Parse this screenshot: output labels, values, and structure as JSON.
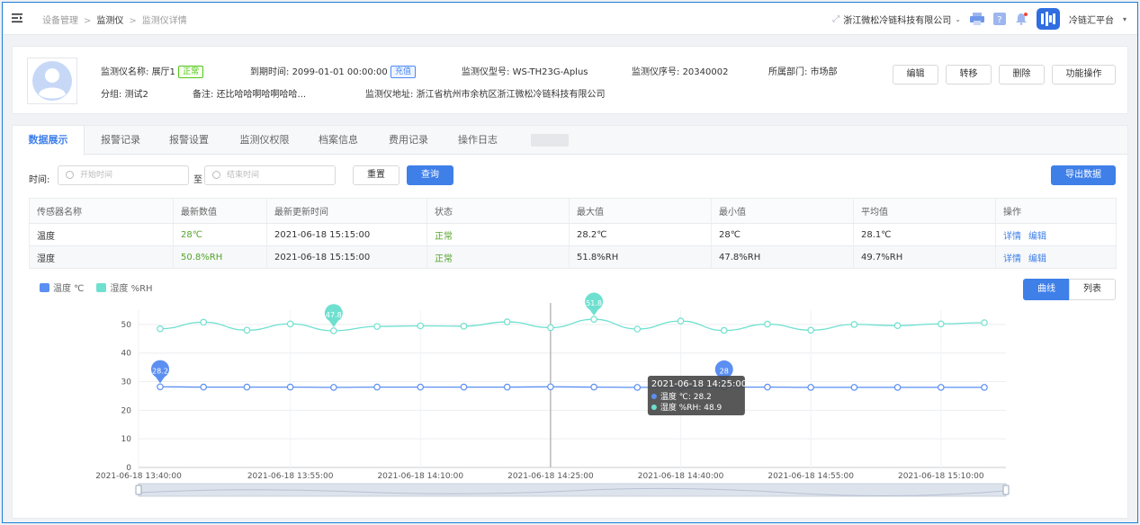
{
  "breadcrumb": {
    "items": [
      "设备管理",
      "监测仪",
      "监测仪详情"
    ],
    "sep": ">"
  },
  "topbar": {
    "company": "浙江微松冷链科技有限公司",
    "platform": "冷链汇平台",
    "company_caret": "⌄",
    "platform_caret": "▾"
  },
  "device": {
    "name_label": "监测仪名称:",
    "name": "展厅1",
    "status": "正常",
    "expire_label": "到期时间:",
    "expire": "2099-01-01 00:00:00",
    "recharge": "充值",
    "model_label": "监测仪型号:",
    "model": "WS-TH23G-Aplus",
    "serial_label": "监测仪序号:",
    "serial": "20340002",
    "dept_label": "所属部门:",
    "dept": "市场部",
    "group_label": "分组:",
    "group": "测试2",
    "remark_label": "备注:",
    "remark": "还比哈哈啊哈啊哈哈...",
    "address_label": "监测仪地址:",
    "address": "浙江省杭州市余杭区浙江微松冷链科技有限公司"
  },
  "actions": {
    "edit": "编辑",
    "transfer": "转移",
    "delete": "删除",
    "functions": "功能操作"
  },
  "tabs": [
    "数据展示",
    "报警记录",
    "报警设置",
    "监测仪权限",
    "档案信息",
    "费用记录",
    "操作日志"
  ],
  "filter": {
    "time_label": "时间:",
    "start_placeholder": "开始时间",
    "to": "至",
    "end_placeholder": "结束时间",
    "reset": "重置",
    "query": "查询",
    "export": "导出数据"
  },
  "table": {
    "headers": [
      "传感器名称",
      "最新数值",
      "最新更新时间",
      "状态",
      "最大值",
      "最小值",
      "平均值",
      "操作"
    ],
    "rows": [
      {
        "name": "温度",
        "latest": "28℃",
        "time": "2021-06-18 15:15:00",
        "status": "正常",
        "max": "28.2℃",
        "min": "28℃",
        "avg": "28.1℃",
        "op1": "详情",
        "op2": "编辑"
      },
      {
        "name": "湿度",
        "latest": "50.8%RH",
        "time": "2021-06-18 15:15:00",
        "status": "正常",
        "max": "51.8%RH",
        "min": "47.8%RH",
        "avg": "49.7%RH",
        "op1": "详情",
        "op2": "编辑"
      }
    ]
  },
  "view_toggle": {
    "curve": "曲线",
    "list": "列表"
  },
  "colors": {
    "accent": "#3f7fe8",
    "temp": "#5b8ff2",
    "humidity": "#6fe0cf",
    "ok": "#52a42a"
  },
  "chart_data": {
    "type": "line",
    "x": [
      "2021-06-18 13:40:00",
      "2021-06-18 13:45:00",
      "2021-06-18 13:50:00",
      "2021-06-18 13:55:00",
      "2021-06-18 14:00:00",
      "2021-06-18 14:05:00",
      "2021-06-18 14:10:00",
      "2021-06-18 14:15:00",
      "2021-06-18 14:20:00",
      "2021-06-18 14:25:00",
      "2021-06-18 14:30:00",
      "2021-06-18 14:35:00",
      "2021-06-18 14:40:00",
      "2021-06-18 14:45:00",
      "2021-06-18 14:50:00",
      "2021-06-18 14:55:00",
      "2021-06-18 15:00:00",
      "2021-06-18 15:05:00",
      "2021-06-18 15:10:00",
      "2021-06-18 15:15:00"
    ],
    "x_ticks": [
      "2021-06-18 13:40:00",
      "2021-06-18 13:55:00",
      "2021-06-18 14:10:00",
      "2021-06-18 14:25:00",
      "2021-06-18 14:40:00",
      "2021-06-18 14:55:00",
      "2021-06-18 15:10:00"
    ],
    "y_ticks": [
      0,
      10,
      20,
      30,
      40,
      50
    ],
    "ylim": [
      0,
      55
    ],
    "series": [
      {
        "name": "温度 ℃",
        "color": "#5b8ff2",
        "values": [
          28.2,
          28.1,
          28.1,
          28.1,
          28.0,
          28.1,
          28.1,
          28.1,
          28.1,
          28.2,
          28.1,
          28.0,
          28.0,
          28.1,
          28.1,
          28.0,
          28.0,
          28.0,
          28.0,
          28.0
        ]
      },
      {
        "name": "湿度 %RH",
        "color": "#6fe0cf",
        "values": [
          48.5,
          50.8,
          48.0,
          50.2,
          47.8,
          49.3,
          49.5,
          49.4,
          50.9,
          48.9,
          51.8,
          48.4,
          51.2,
          47.9,
          50.1,
          48.0,
          50.0,
          49.6,
          50.2,
          50.6
        ]
      }
    ],
    "markers": [
      {
        "series": 0,
        "index": 0,
        "label": "28.2"
      },
      {
        "series": 0,
        "index": 13,
        "label": "28"
      },
      {
        "series": 1,
        "index": 4,
        "label": "47.8"
      },
      {
        "series": 1,
        "index": 10,
        "label": "51.8"
      }
    ],
    "tooltip": {
      "index": 9,
      "title": "2021-06-18 14:25:00",
      "lines": [
        "温度 ℃: 28.2",
        "湿度 %RH: 48.9"
      ]
    },
    "grid": true,
    "legend_position": "top-left"
  }
}
